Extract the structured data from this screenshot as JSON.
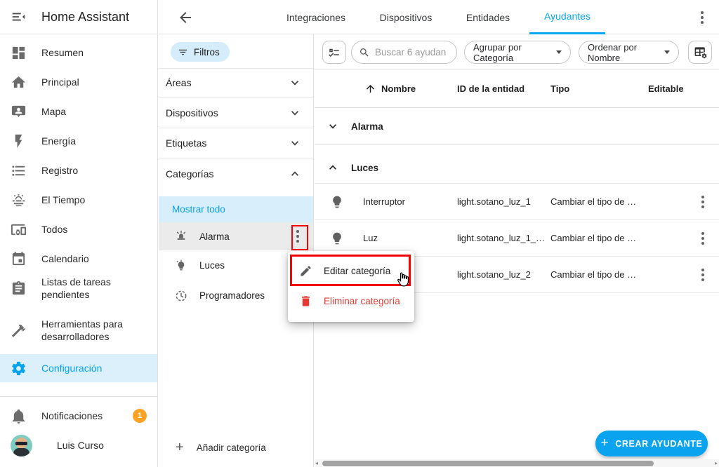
{
  "colors": {
    "accent": "#03a9f4",
    "annotation_red": "#f30303",
    "danger_red": "#e53935",
    "badge_orange": "#fca326",
    "selected_bg": "#dcf0fb"
  },
  "header": {
    "title": "Home Assistant",
    "tabs": [
      {
        "label": "Integraciones",
        "active": false
      },
      {
        "label": "Dispositivos",
        "active": false
      },
      {
        "label": "Entidades",
        "active": false
      },
      {
        "label": "Ayudantes",
        "active": true
      }
    ]
  },
  "sidebar": {
    "items": [
      {
        "label": "Resumen",
        "icon": "dashboard-icon"
      },
      {
        "label": "Principal",
        "icon": "home-icon"
      },
      {
        "label": "Mapa",
        "icon": "account-map-icon"
      },
      {
        "label": "Energía",
        "icon": "lightning-icon"
      },
      {
        "label": "Registro",
        "icon": "list-icon"
      },
      {
        "label": "El Tiempo",
        "icon": "weather-icon"
      },
      {
        "label": "Todos",
        "icon": "devices-icon"
      },
      {
        "label": "Calendario",
        "icon": "calendar-icon"
      },
      {
        "label": "Listas de tareas pendientes",
        "icon": "clipboard-icon"
      },
      {
        "label": "Herramientas para desarrolladores",
        "icon": "hammer-icon"
      },
      {
        "label": "Configuración",
        "icon": "gear-icon",
        "active": true
      }
    ],
    "notifications": {
      "label": "Notificaciones",
      "badge": "1"
    },
    "user": {
      "name": "Luis Curso"
    }
  },
  "filters": {
    "filters_button": "Filtros",
    "sections": [
      {
        "label": "Áreas",
        "expanded": false
      },
      {
        "label": "Dispositivos",
        "expanded": false
      },
      {
        "label": "Etiquetas",
        "expanded": false
      },
      {
        "label": "Categorías",
        "expanded": true
      }
    ],
    "categories": {
      "show_all": "Mostrar todo",
      "items": [
        {
          "label": "Alarma",
          "icon": "siren-icon"
        },
        {
          "label": "Luces",
          "icon": "lightbulb-icon"
        },
        {
          "label": "Programadores",
          "icon": "timer-icon"
        }
      ],
      "add_label": "Añadir categoría"
    }
  },
  "toolbar": {
    "search_placeholder": "Buscar 6 ayudan",
    "group_by_label": "Agrupar por Categoría",
    "sort_by_label": "Ordenar por Nombre"
  },
  "table": {
    "columns": [
      "Nombre",
      "ID de la entidad",
      "Tipo",
      "Editable"
    ],
    "groups": [
      {
        "name": "Alarma",
        "collapsed": true
      },
      {
        "name": "Luces",
        "collapsed": false
      }
    ],
    "rows": [
      {
        "name": "Interruptor",
        "entity_id": "light.sotano_luz_1",
        "tipo": "Cambiar el tipo de …"
      },
      {
        "name": "Luz",
        "entity_id": "light.sotano_luz_1_…",
        "tipo": "Cambiar el tipo de …"
      },
      {
        "name": "",
        "entity_id": "light.sotano_luz_2",
        "tipo": "Cambiar el tipo de …"
      }
    ]
  },
  "context_menu": {
    "items": [
      {
        "label": "Editar categoría",
        "icon": "pencil-icon"
      },
      {
        "label": "Eliminar categoría",
        "icon": "trash-icon",
        "danger": true
      }
    ]
  },
  "fab": {
    "label": "CREAR AYUDANTE"
  }
}
